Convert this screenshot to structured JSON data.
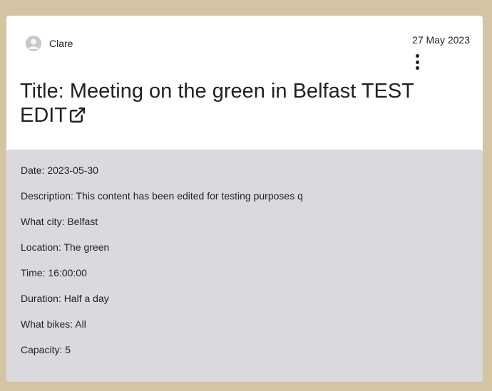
{
  "post": {
    "author": "Clare",
    "date": "27 May 2023",
    "title": "Title: Meeting on the green in Belfast TEST EDIT"
  },
  "details": {
    "date": "Date: 2023-05-30",
    "description": "Description: This content has been edited for testing purposes q",
    "city": "What city: Belfast",
    "location": "Location: The green",
    "time": "Time: 16:00:00",
    "duration": "Duration: Half a day",
    "bikes": "What bikes: All",
    "capacity": "Capacity: 5"
  },
  "icons": {
    "avatar": "user-avatar-icon",
    "menu": "kebab-menu-icon",
    "external": "external-link-icon"
  },
  "colors": {
    "page_background": "#d3c4a3",
    "card_background": "#ffffff",
    "details_background": "#dadade"
  }
}
